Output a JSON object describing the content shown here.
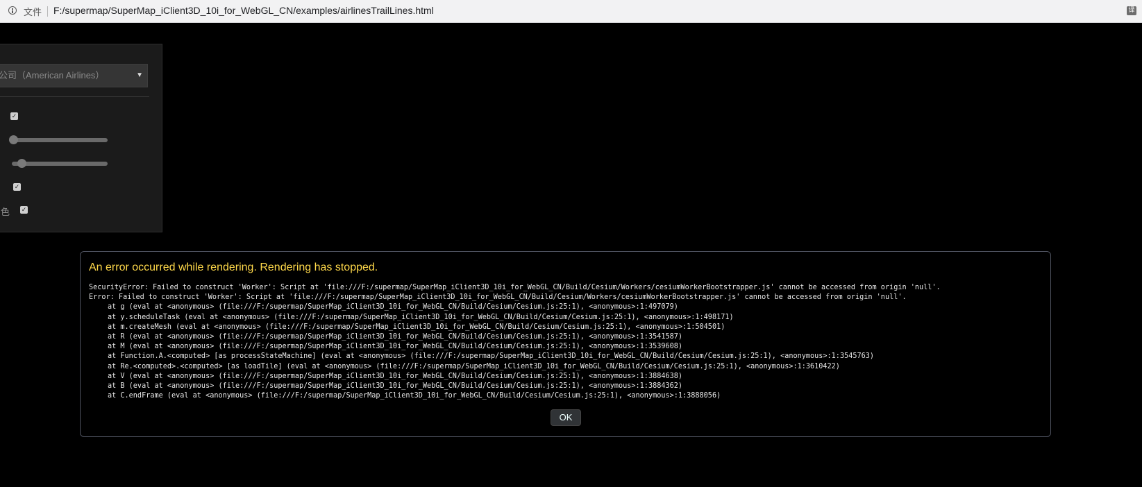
{
  "browser": {
    "scheme_label": "文件",
    "url": "F:/supermap/SuperMap_iClient3D_10i_for_WebGL_CN/examples/airlinesTrailLines.html",
    "translate_icon_glyph": "译"
  },
  "toolbar": {
    "airline_select_value": "公司（American Airlines）",
    "rows": [
      {
        "label": "",
        "checked": true
      },
      {
        "label": ""
      },
      {
        "label": ""
      },
      {
        "label": "",
        "checked": true
      },
      {
        "label": "色",
        "checked": true
      }
    ],
    "checkbox_mark": "✓",
    "sliders": [
      {
        "value_fraction": 0.05
      },
      {
        "value_fraction": 0.1
      }
    ]
  },
  "error": {
    "title": "An error occurred while rendering. Rendering has stopped.",
    "lines": [
      "SecurityError: Failed to construct 'Worker': Script at 'file:///F:/supermap/SuperMap_iClient3D_10i_for_WebGL_CN/Build/Cesium/Workers/cesiumWorkerBootstrapper.js' cannot be accessed from origin 'null'.",
      "Error: Failed to construct 'Worker': Script at 'file:///F:/supermap/SuperMap_iClient3D_10i_for_WebGL_CN/Build/Cesium/Workers/cesiumWorkerBootstrapper.js' cannot be accessed from origin 'null'.",
      "at g (eval at <anonymous> (file:///F:/supermap/SuperMap_iClient3D_10i_for_WebGL_CN/Build/Cesium/Cesium.js:25:1), <anonymous>:1:497079)",
      "at y.scheduleTask (eval at <anonymous> (file:///F:/supermap/SuperMap_iClient3D_10i_for_WebGL_CN/Build/Cesium/Cesium.js:25:1), <anonymous>:1:498171)",
      "at m.createMesh (eval at <anonymous> (file:///F:/supermap/SuperMap_iClient3D_10i_for_WebGL_CN/Build/Cesium/Cesium.js:25:1), <anonymous>:1:504501)",
      "at R (eval at <anonymous> (file:///F:/supermap/SuperMap_iClient3D_10i_for_WebGL_CN/Build/Cesium/Cesium.js:25:1), <anonymous>:1:3541587)",
      "at M (eval at <anonymous> (file:///F:/supermap/SuperMap_iClient3D_10i_for_WebGL_CN/Build/Cesium/Cesium.js:25:1), <anonymous>:1:3539608)",
      "at Function.A.<computed> [as processStateMachine] (eval at <anonymous> (file:///F:/supermap/SuperMap_iClient3D_10i_for_WebGL_CN/Build/Cesium/Cesium.js:25:1), <anonymous>:1:3545763)",
      "at Re.<computed>.<computed> [as loadTile] (eval at <anonymous> (file:///F:/supermap/SuperMap_iClient3D_10i_for_WebGL_CN/Build/Cesium/Cesium.js:25:1), <anonymous>:1:3610422)",
      "at V (eval at <anonymous> (file:///F:/supermap/SuperMap_iClient3D_10i_for_WebGL_CN/Build/Cesium/Cesium.js:25:1), <anonymous>:1:3884638)",
      "at B (eval at <anonymous> (file:///F:/supermap/SuperMap_iClient3D_10i_for_WebGL_CN/Build/Cesium/Cesium.js:25:1), <anonymous>:1:3884362)",
      "at C.endFrame (eval at <anonymous> (file:///F:/supermap/SuperMap_iClient3D_10i_for_WebGL_CN/Build/Cesium/Cesium.js:25:1), <anonymous>:1:3888056)"
    ],
    "ok_label": "OK"
  },
  "colors": {
    "page_background": "#000000",
    "error_title": "#ffd94a",
    "error_text": "#e8e8e8",
    "panel_background": "#1b1b1b"
  }
}
